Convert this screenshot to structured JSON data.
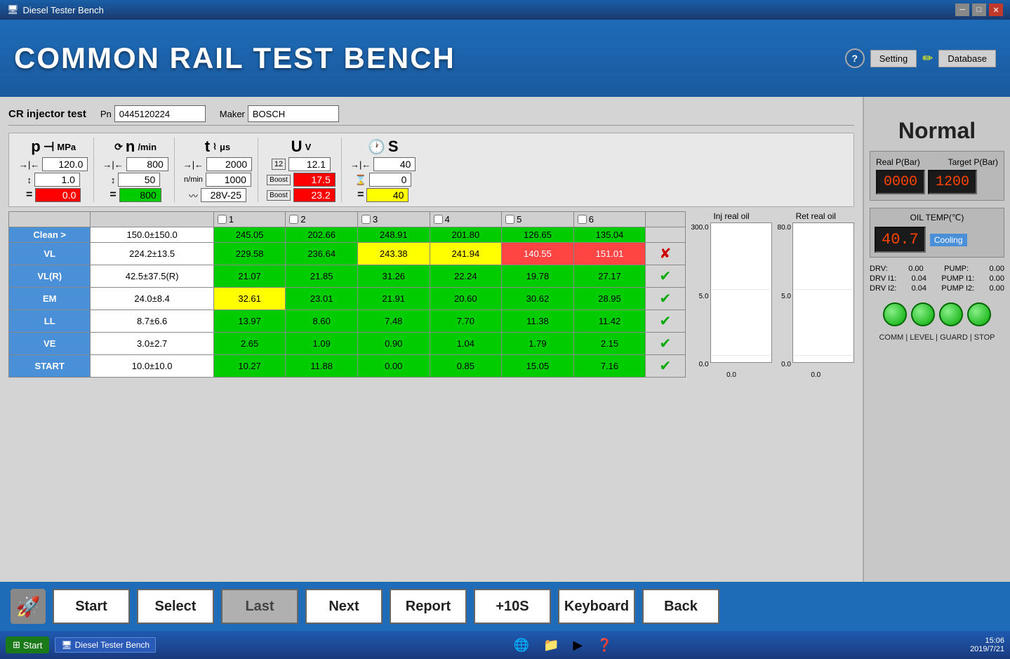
{
  "window": {
    "title": "Diesel Tester Bench"
  },
  "header": {
    "title": "COMMON RAIL TEST BENCH",
    "help_label": "?",
    "setting_label": "Setting",
    "edit_icon": "✏",
    "database_label": "Database"
  },
  "test_info": {
    "label": "CR injector test",
    "pn_label": "Pn",
    "pn_value": "0445120224",
    "maker_label": "Maker",
    "maker_value": "BOSCH"
  },
  "gauges": {
    "pressure": {
      "symbol": "p",
      "unit": "MPa",
      "setpoint_arrow": "→|←",
      "setpoint_value": "120.0",
      "step_arrow": "↕",
      "step_value": "1.0",
      "actual": "0.0",
      "actual_class": "red"
    },
    "speed": {
      "symbol": "n",
      "unit": "/min",
      "setpoint_value": "800",
      "step_value": "50",
      "actual": "800",
      "actual_class": "green",
      "sub1": "1000",
      "sub2": "28V-25"
    },
    "time": {
      "symbol": "t",
      "unit": "μs",
      "setpoint_value": "2000",
      "step_value": "1000",
      "actual": "28V-25"
    },
    "voltage": {
      "symbol": "U",
      "unit": "V",
      "setpoint_value": "12.1",
      "val1": "17.5",
      "val1_class": "red",
      "val2": "23.2",
      "val2_class": "red"
    },
    "time2": {
      "symbol": "S",
      "unit": "S",
      "setpoint_value": "40",
      "step_value": "0",
      "actual": "40",
      "actual_class": "yellow"
    }
  },
  "table": {
    "col_headers": [
      "",
      "",
      "1",
      "2",
      "3",
      "4",
      "5",
      "6",
      ""
    ],
    "rows": [
      {
        "label": "Clean >",
        "spec": "150.0±150.0",
        "vals": [
          "245.05",
          "202.66",
          "248.91",
          "201.80",
          "126.65",
          "135.04"
        ],
        "val_classes": [
          "green",
          "green",
          "green",
          "green",
          "green",
          "green"
        ],
        "status": ""
      },
      {
        "label": "VL",
        "spec": "224.2±13.5",
        "vals": [
          "229.58",
          "236.64",
          "243.38",
          "241.94",
          "140.55",
          "151.01"
        ],
        "val_classes": [
          "green",
          "green",
          "yellow",
          "yellow",
          "red",
          "red"
        ],
        "status": "fail"
      },
      {
        "label": "VL(R)",
        "spec": "42.5±37.5(R)",
        "vals": [
          "21.07",
          "21.85",
          "31.26",
          "22.24",
          "19.78",
          "27.17"
        ],
        "val_classes": [
          "green",
          "green",
          "green",
          "green",
          "green",
          "green"
        ],
        "status": "ok"
      },
      {
        "label": "EM",
        "spec": "24.0±8.4",
        "vals": [
          "32.61",
          "23.01",
          "21.91",
          "20.60",
          "30.62",
          "28.95"
        ],
        "val_classes": [
          "yellow",
          "green",
          "green",
          "green",
          "green",
          "green"
        ],
        "status": "ok"
      },
      {
        "label": "LL",
        "spec": "8.7±6.6",
        "vals": [
          "13.97",
          "8.60",
          "7.48",
          "7.70",
          "11.38",
          "11.42"
        ],
        "val_classes": [
          "green",
          "green",
          "green",
          "green",
          "green",
          "green"
        ],
        "status": "ok"
      },
      {
        "label": "VE",
        "spec": "3.0±2.7",
        "vals": [
          "2.65",
          "1.09",
          "0.90",
          "1.04",
          "1.79",
          "2.15"
        ],
        "val_classes": [
          "green",
          "green",
          "green",
          "green",
          "green",
          "green"
        ],
        "status": "ok"
      },
      {
        "label": "START",
        "spec": "10.0±10.0",
        "vals": [
          "10.27",
          "11.88",
          "0.00",
          "0.85",
          "15.05",
          "7.16"
        ],
        "val_classes": [
          "green",
          "green",
          "green",
          "green",
          "green",
          "green"
        ],
        "status": "ok"
      }
    ]
  },
  "inj_chart": {
    "title": "Inj real oil",
    "max_label": "300.0",
    "mid_label": "5.0",
    "min_label": "0.0",
    "bottom_label": "0.0"
  },
  "ret_chart": {
    "title": "Ret real oil",
    "max_label": "80.0",
    "mid_label": "5.0",
    "min_label": "0.0",
    "bottom_label": "0.0"
  },
  "right_panel": {
    "status": "Normal",
    "real_p_label": "Real P(Bar)",
    "target_p_label": "Target P(Bar)",
    "real_p_value": "0000",
    "target_p_value": "1200",
    "oil_temp_label": "OIL TEMP(℃)",
    "oil_temp_value": "40.7",
    "cooling_label": "Cooling",
    "drv_items": [
      {
        "label": "DRV:",
        "value": "0.00",
        "label2": "PUMP:",
        "value2": "0.00"
      },
      {
        "label": "DRV I1:",
        "value": "0.04",
        "label2": "PUMP I1:",
        "value2": "0.00"
      },
      {
        "label": "DRV I2:",
        "value": "0.04",
        "label2": "PUMP I2:",
        "value2": "0.00"
      }
    ],
    "indicators": [
      "●",
      "●",
      "●",
      "●"
    ],
    "indicator_labels": "COMM | LEVEL | GUARD | STOP"
  },
  "bottom_bar": {
    "start_label": "Start",
    "select_label": "Select",
    "last_label": "Last",
    "next_label": "Next",
    "report_label": "Report",
    "plus10s_label": "+10S",
    "keyboard_label": "Keyboard",
    "back_label": "Back"
  },
  "taskbar": {
    "start_label": "Start",
    "app_label": "Diesel Tester Bench",
    "time": "15:06",
    "date": "2019/7/21"
  }
}
